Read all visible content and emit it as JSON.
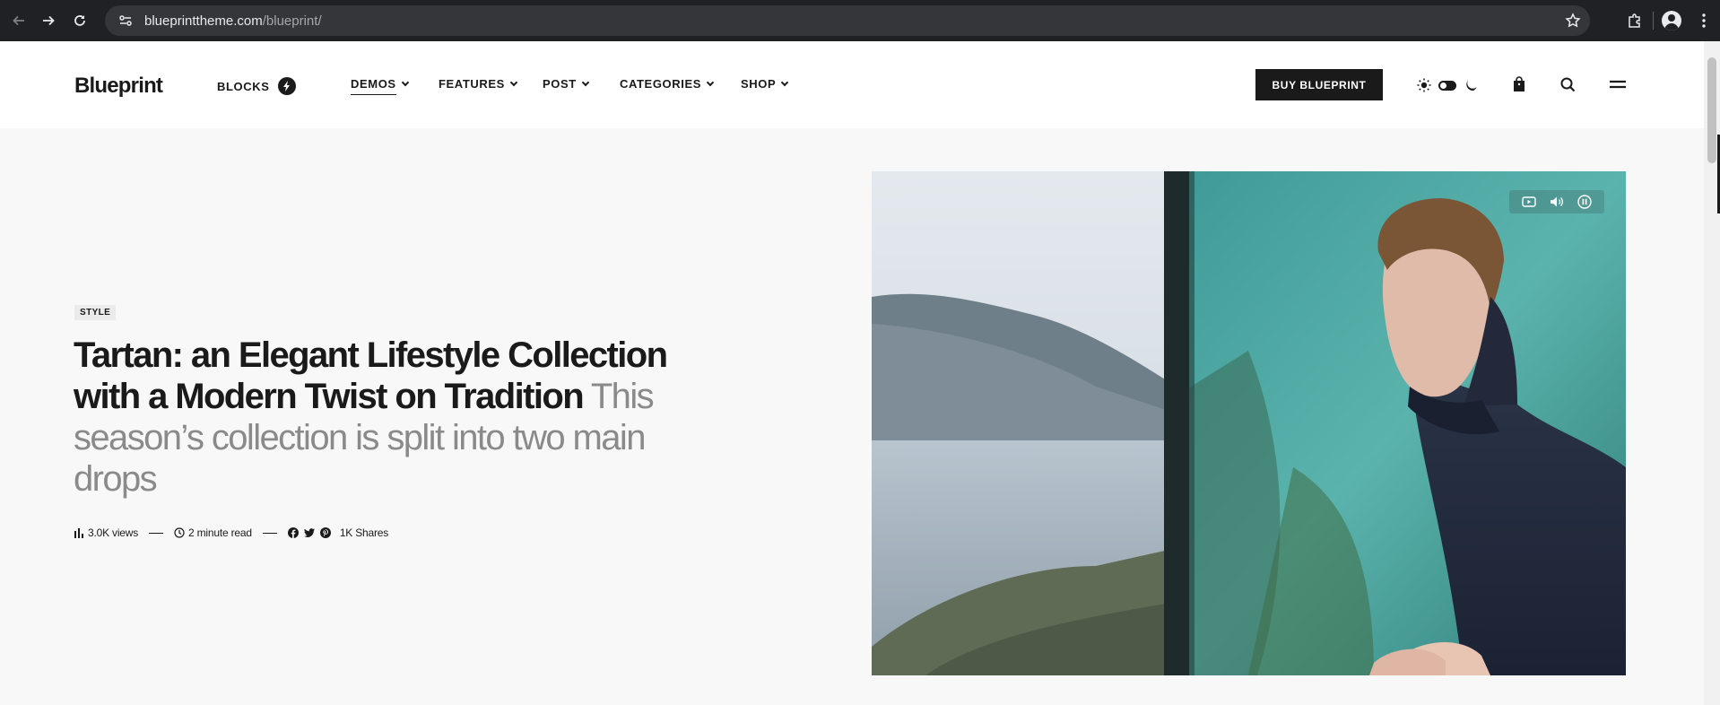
{
  "browser": {
    "url_domain": "blueprinttheme.com",
    "url_path": "/blueprint/"
  },
  "header": {
    "logo": "Blueprint",
    "menu": [
      {
        "label": "BLOCKS"
      },
      {
        "label": "DEMOS"
      },
      {
        "label": "FEATURES"
      },
      {
        "label": "POST"
      },
      {
        "label": "CATEGORIES"
      },
      {
        "label": "SHOP"
      }
    ],
    "buy_button": "BUY BLUEPRINT"
  },
  "hero": {
    "category": "STYLE",
    "title": "Tartan: an Elegant Lifestyle Collection with a Modern Twist on Tradition",
    "excerpt": "This season’s collection is split into two main drops",
    "meta": {
      "views": "3.0K views",
      "read_time": "2 minute read",
      "shares": "1K Shares"
    }
  },
  "colors": {
    "primary": "#1a1a1a",
    "background": "#f8f8f8",
    "excerpt": "#8a8a8a"
  }
}
